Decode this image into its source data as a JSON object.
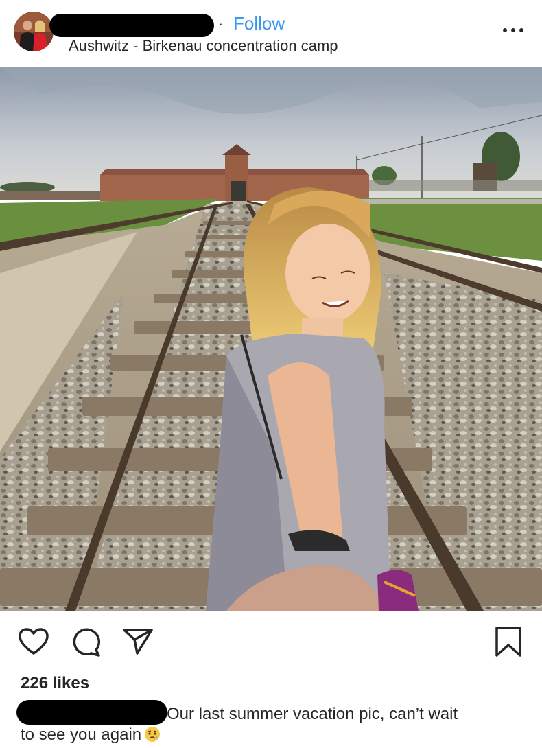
{
  "post": {
    "username_redacted": true,
    "separator": "·",
    "follow_label": "Follow",
    "location": "Aushwitz - Birkenau concentration camp"
  },
  "actions": {
    "like_icon": "heart-outline-icon",
    "comment_icon": "comment-icon",
    "share_icon": "paper-plane-icon",
    "save_icon": "bookmark-icon",
    "more_icon": "more-dots-icon"
  },
  "likes": "226 likes",
  "caption": {
    "line1": "Our last summer vacation pic, can’t wait",
    "line2": "to see you again",
    "emoji": "disappointed-relieved-face-icon"
  },
  "colors": {
    "accent": "#3897f0",
    "text": "#262626"
  }
}
